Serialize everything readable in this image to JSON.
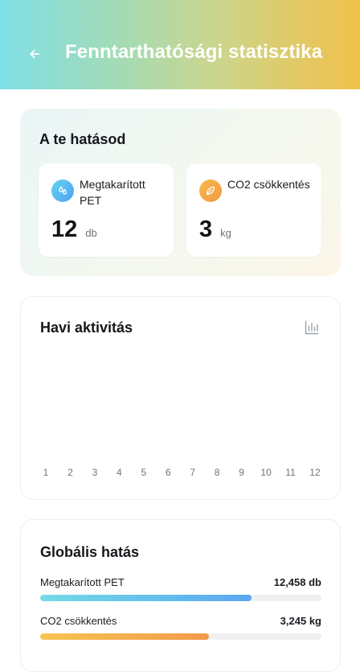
{
  "header": {
    "title": "Fenntarthatósági statisztika",
    "back_icon": "arrow-left-icon"
  },
  "impact": {
    "title": "A te hatásod",
    "pet": {
      "label": "Megtakarított PET",
      "value": "12",
      "unit": "db",
      "icon": "droplets-icon",
      "color": "#4aa2f0"
    },
    "co2": {
      "label": "CO2 csökkentés",
      "value": "3",
      "unit": "kg",
      "icon": "leaf-icon",
      "color": "#f29a3e"
    }
  },
  "activity": {
    "title": "Havi aktivitás",
    "chart_icon": "bar-chart-icon",
    "months": [
      "1",
      "2",
      "3",
      "4",
      "5",
      "6",
      "7",
      "8",
      "9",
      "10",
      "11",
      "12"
    ]
  },
  "global": {
    "title": "Globális hatás",
    "pet": {
      "label": "Megtakarított PET",
      "value": "12,458 db",
      "progress": 0.75
    },
    "co2": {
      "label": "CO2 csökkentés",
      "value": "3,245 kg",
      "progress": 0.6
    }
  },
  "colors": {
    "header_gradient_start": "#7fdfe6",
    "header_gradient_end": "#f2c04a",
    "pet_accent": "#5aa7f2",
    "co2_accent": "#f29a4c"
  }
}
